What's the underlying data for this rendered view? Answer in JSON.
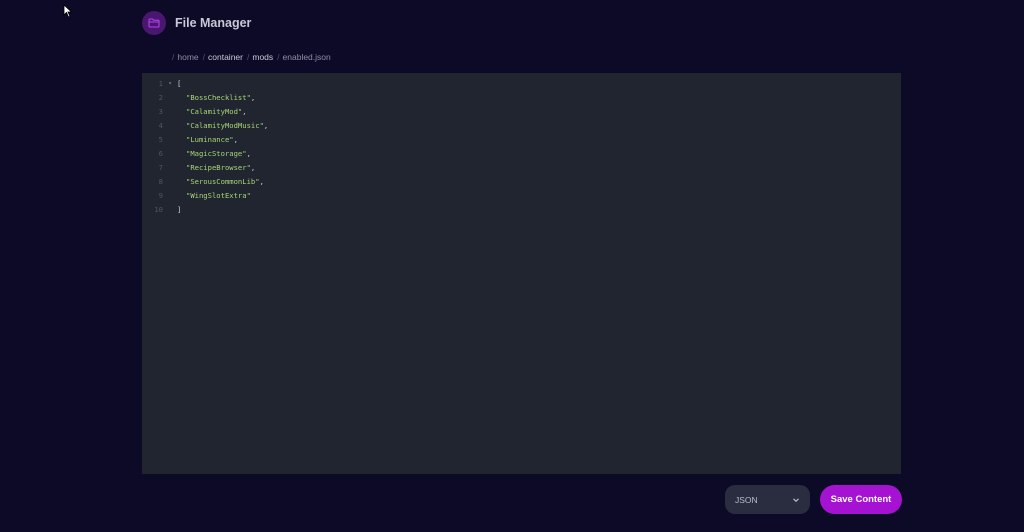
{
  "header": {
    "title": "File Manager",
    "icon": "folder-icon",
    "accent_color": "#4a1770"
  },
  "breadcrumb": [
    {
      "label": "home",
      "link": false
    },
    {
      "label": "container",
      "link": true
    },
    {
      "label": "mods",
      "link": true
    },
    {
      "label": "enabled.json",
      "link": false
    }
  ],
  "editor": {
    "background": "#21252f",
    "lines": [
      {
        "num": "1",
        "fold": true,
        "text": "[",
        "kind": "punct",
        "indent": 0
      },
      {
        "num": "2",
        "fold": false,
        "text": "\"BossChecklist\"",
        "suffix": ",",
        "kind": "str",
        "indent": 1
      },
      {
        "num": "3",
        "fold": false,
        "text": "\"CalamityMod\"",
        "suffix": ",",
        "kind": "str",
        "indent": 1
      },
      {
        "num": "4",
        "fold": false,
        "text": "\"CalamityModMusic\"",
        "suffix": ",",
        "kind": "str",
        "indent": 1
      },
      {
        "num": "5",
        "fold": false,
        "text": "\"Luminance\"",
        "suffix": ",",
        "kind": "str",
        "indent": 1
      },
      {
        "num": "6",
        "fold": false,
        "text": "\"MagicStorage\"",
        "suffix": ",",
        "kind": "str",
        "indent": 1
      },
      {
        "num": "7",
        "fold": false,
        "text": "\"RecipeBrowser\"",
        "suffix": ",",
        "kind": "str",
        "indent": 1
      },
      {
        "num": "8",
        "fold": false,
        "text": "\"SerousCommonLib\"",
        "suffix": ",",
        "kind": "str",
        "indent": 1
      },
      {
        "num": "9",
        "fold": false,
        "text": "\"WingSlotExtra\"",
        "suffix": "",
        "kind": "str",
        "indent": 1
      },
      {
        "num": "10",
        "fold": false,
        "text": "]",
        "kind": "punct",
        "indent": 0
      }
    ]
  },
  "footer": {
    "language_select": {
      "value": "JSON",
      "icon": "chevron-down-icon"
    },
    "save_label": "Save Content",
    "save_color": "#a612d2"
  }
}
